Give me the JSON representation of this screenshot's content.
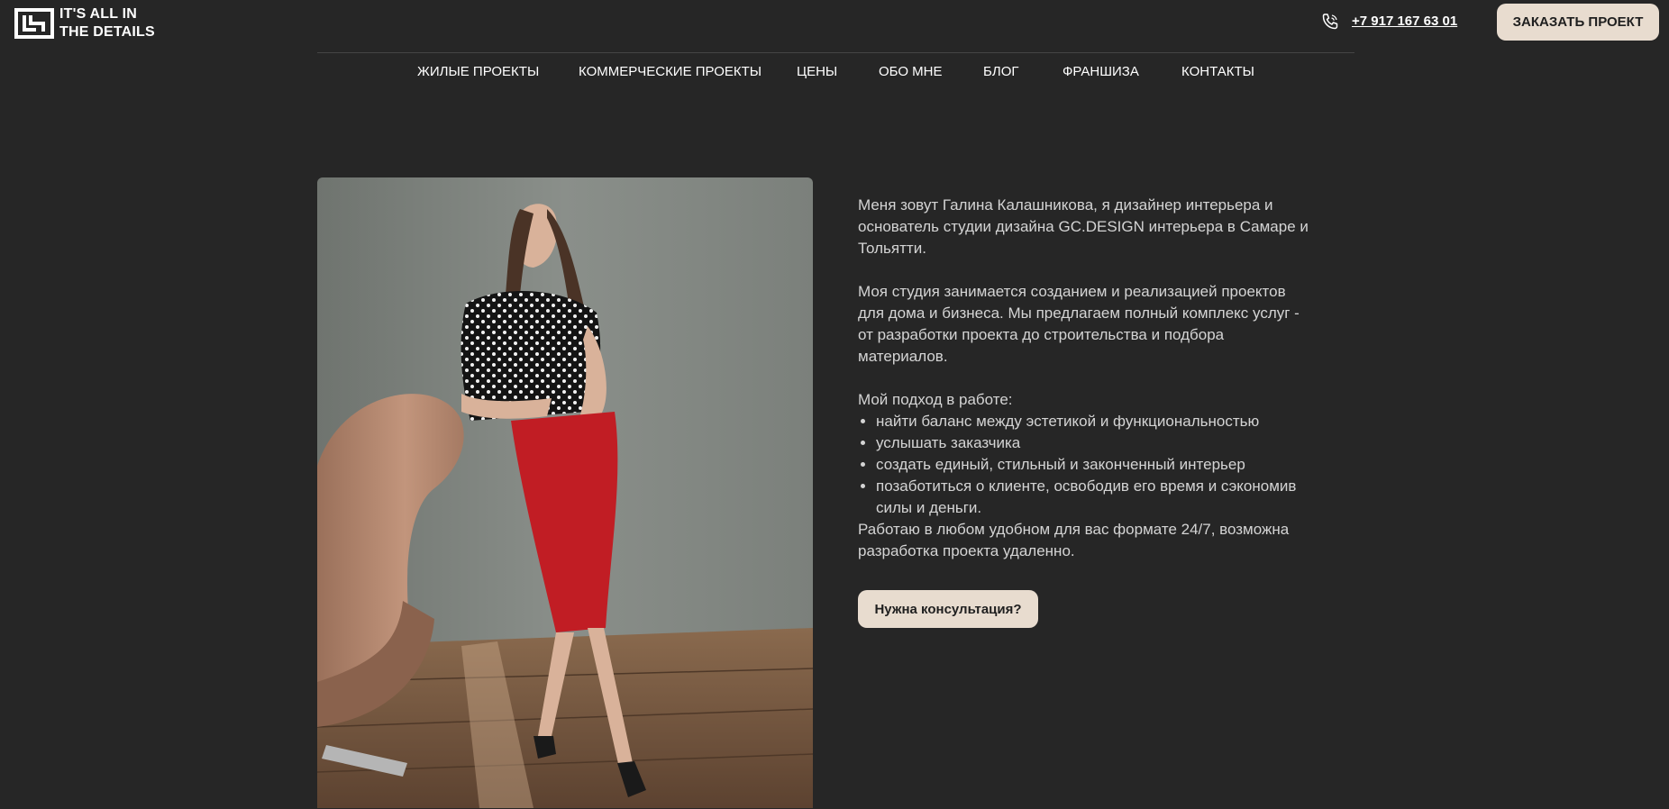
{
  "header": {
    "logo": {
      "line1": "IT'S ALL IN",
      "line2": "THE DETAILS",
      "icon": "logo-mark-icon"
    },
    "phone": {
      "icon": "phone-icon",
      "number": "+7 917 167 63 01"
    },
    "order_button": "ЗАКАЗАТЬ ПРОЕКТ"
  },
  "nav": {
    "items": [
      {
        "label": "ЖИЛЫЕ ПРОЕКТЫ"
      },
      {
        "label": "КОММЕРЧЕСКИЕ ПРОЕКТЫ"
      },
      {
        "label": "ЦЕНЫ"
      },
      {
        "label": "ОБО МНЕ"
      },
      {
        "label": "БЛОГ"
      },
      {
        "label": "ФРАНШИЗА"
      },
      {
        "label": "КОНТАКТЫ"
      }
    ]
  },
  "about": {
    "intro": "Меня зовут Галина Калашникова, я дизайнер интерьера и основатель студии дизайна GC.DESIGN интерьера в Самаре и Тольятти.",
    "studio": "Моя студия занимается созданием и реализацией проектов для дома и бизнеса. Мы предлагаем полный комплекс услуг - от разработки проекта до строительства и подбора материалов.",
    "approach_title": "Мой подход в работе:",
    "approach_items": [
      "найти баланс между эстетикой и функциональностью",
      "услышать заказчика",
      "создать единый, стильный и законченный интерьер",
      "позаботиться о клиенте, освободив его время и сэкономив силы и деньги."
    ],
    "format": "Работаю в любом удобном для вас формате 24/7, возможна разработка проекта удаленно.",
    "consult_button": "Нужна консультация?"
  },
  "colors": {
    "background": "#262626",
    "accent_button": "#e8dccf",
    "text": "#d4d4d4"
  }
}
